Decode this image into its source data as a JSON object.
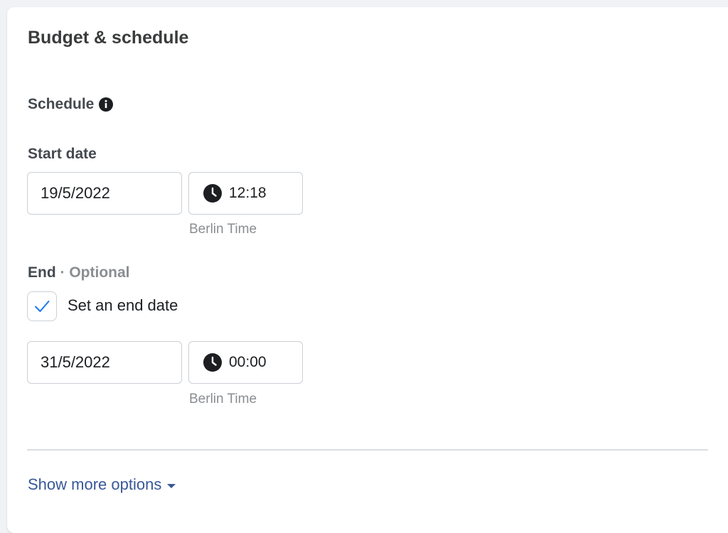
{
  "card": {
    "title": "Budget & schedule"
  },
  "schedule": {
    "label": "Schedule",
    "info_icon": "info-icon",
    "start": {
      "label": "Start date",
      "date": "19/5/2022",
      "time": "12:18",
      "timezone": "Berlin Time"
    },
    "end": {
      "label": "End",
      "optional": " · Optional",
      "checkbox_label": "Set an end date",
      "checked": true,
      "date": "31/5/2022",
      "time": "00:00",
      "timezone": "Berlin Time"
    }
  },
  "footer": {
    "more_label": "Show more options"
  },
  "colors": {
    "link": "#385898",
    "checkmark": "#1877f2",
    "muted": "#8a8d91",
    "border": "#ccd0d5"
  }
}
